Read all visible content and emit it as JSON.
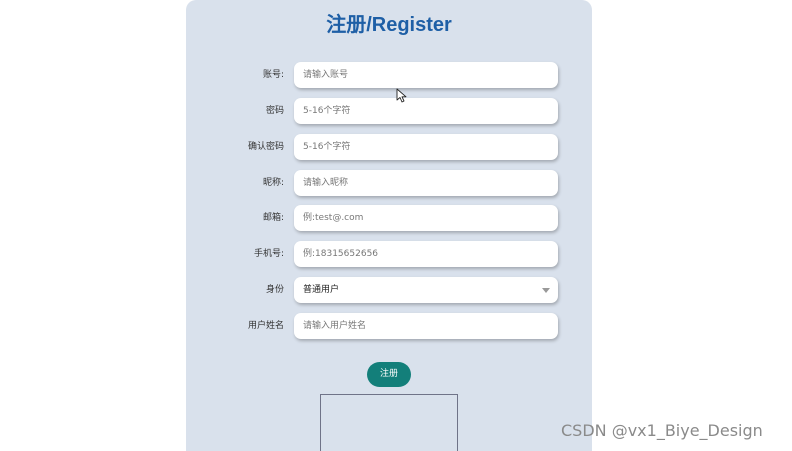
{
  "form": {
    "title": "注册/Register",
    "fields": [
      {
        "label": "账号:",
        "placeholder": "请输入账号"
      },
      {
        "label": "密码",
        "placeholder": "5-16个字符"
      },
      {
        "label": "确认密码",
        "placeholder": "5-16个字符"
      },
      {
        "label": "昵称:",
        "placeholder": "请输入昵称"
      },
      {
        "label": "邮箱:",
        "placeholder": "例:test@.com"
      },
      {
        "label": "手机号:",
        "placeholder": "例:18315652656"
      },
      {
        "label": "用户姓名",
        "placeholder": "请输入用户姓名"
      }
    ],
    "identity": {
      "label": "身份",
      "selected": "普通用户"
    },
    "submit_label": "注册"
  },
  "watermark": "CSDN @vx1_Biye_Design",
  "icons": {
    "cursor": "mouse-pointer-icon",
    "dropdown": "chevron-down-icon"
  }
}
